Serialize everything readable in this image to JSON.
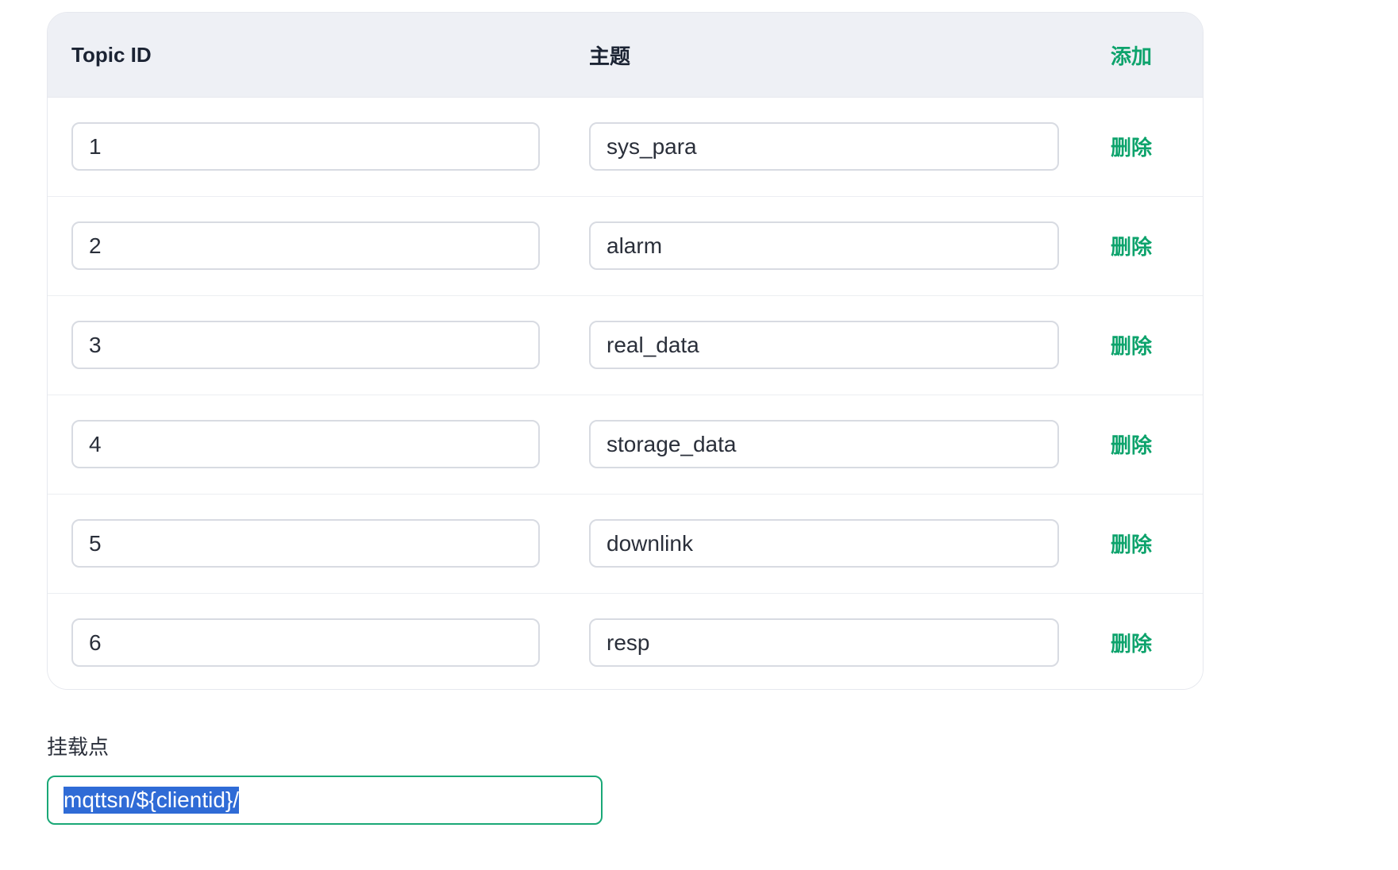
{
  "table": {
    "headers": {
      "topic_id": "Topic ID",
      "topic_name": "主题",
      "add": "添加"
    },
    "rows": [
      {
        "id": "1",
        "name": "sys_para",
        "delete_label": "删除"
      },
      {
        "id": "2",
        "name": "alarm",
        "delete_label": "删除"
      },
      {
        "id": "3",
        "name": "real_data",
        "delete_label": "删除"
      },
      {
        "id": "4",
        "name": "storage_data",
        "delete_label": "删除"
      },
      {
        "id": "5",
        "name": "downlink",
        "delete_label": "删除"
      },
      {
        "id": "6",
        "name": "resp",
        "delete_label": "删除"
      }
    ]
  },
  "mountpoint": {
    "label": "挂载点",
    "value": "mqttsn/${clientid}/",
    "text_selected": true
  },
  "colors": {
    "accent": "#0da36c",
    "header_bg": "#eef0f5",
    "selection": "#2f6bd6"
  }
}
